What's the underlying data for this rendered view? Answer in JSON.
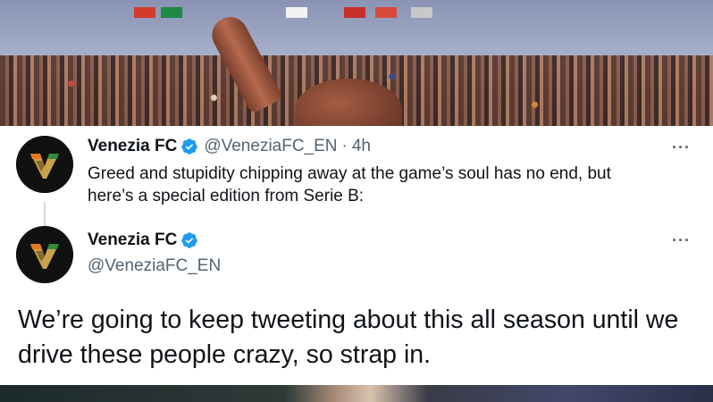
{
  "tweet": {
    "author_name": "Venezia FC",
    "author_handle": "@VeneziaFC_EN",
    "separator": "·",
    "time": "4h",
    "more_icon": "···",
    "text": "Greed and stupidity chipping away at the game’s soul has no end, but here’s a special edition from Serie B:"
  },
  "quoted": {
    "author_name": "Venezia FC",
    "author_handle": "@VeneziaFC_EN",
    "more_icon": "···",
    "text": "We’re going to keep tweeting about this all season until we drive these people crazy, so strap in."
  },
  "colors": {
    "verified_blue": "#1d9bf0",
    "logo_orange": "#e8781e",
    "logo_green": "#2f8a3a",
    "logo_gold": "#c8a24a"
  },
  "icons": [
    "verified-badge-icon",
    "more-options-icon",
    "venezia-logo"
  ]
}
